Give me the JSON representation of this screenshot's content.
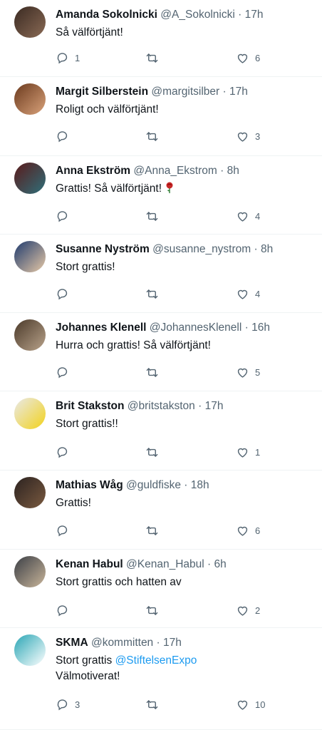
{
  "tweets": [
    {
      "name": "Amanda Sokolnicki",
      "handle": "@A_Sokolnicki",
      "time": "17h",
      "text": "Så välförtjänt!",
      "replies": "1",
      "retweets": "",
      "likes": "6",
      "avatar_colors": [
        "#3a2a22",
        "#8a6a55"
      ]
    },
    {
      "name": "Margit Silberstein",
      "handle": "@margitsilber",
      "time": "17h",
      "text": "Roligt och välförtjänt!",
      "replies": "",
      "retweets": "",
      "likes": "3",
      "avatar_colors": [
        "#6b3a1e",
        "#d9a27a"
      ]
    },
    {
      "name": "Anna Ekström",
      "handle": "@Anna_Ekstrom",
      "time": "8h",
      "text": "Grattis! Så välförtjänt!",
      "emoji": "rose-emoji",
      "replies": "",
      "retweets": "",
      "likes": "4",
      "avatar_colors": [
        "#5a1a1a",
        "#2f6f7a"
      ]
    },
    {
      "name": "Susanne Nyström",
      "handle": "@susanne_nystrom",
      "time": "8h",
      "text": "Stort grattis!",
      "replies": "",
      "retweets": "",
      "likes": "4",
      "avatar_colors": [
        "#1f3b6e",
        "#e7c9a6"
      ]
    },
    {
      "name": "Johannes Klenell",
      "handle": "@JohannesKlenell",
      "time": "16h",
      "text": "Hurra och grattis! Så välförtjänt!",
      "replies": "",
      "retweets": "",
      "likes": "5",
      "avatar_colors": [
        "#4b3a2a",
        "#b8a28a"
      ]
    },
    {
      "name": "Brit Stakston",
      "handle": "@britstakston",
      "time": "17h",
      "text": "Stort grattis!!",
      "replies": "",
      "retweets": "",
      "likes": "1",
      "avatar_colors": [
        "#e9e9e9",
        "#f2d21b"
      ]
    },
    {
      "name": "Mathias Wåg",
      "handle": "@guldfiske",
      "time": "18h",
      "text": "Grattis!",
      "replies": "",
      "retweets": "",
      "likes": "6",
      "avatar_colors": [
        "#2b2220",
        "#7a5a40"
      ]
    },
    {
      "name": "Kenan Habul",
      "handle": "@Kenan_Habul",
      "time": "6h",
      "text": "Stort grattis och hatten av",
      "replies": "",
      "retweets": "",
      "likes": "2",
      "avatar_colors": [
        "#3b3f46",
        "#c9b59a"
      ]
    },
    {
      "name": "SKMA",
      "handle": "@kommitten",
      "time": "17h",
      "text": "Stort grattis",
      "link": "@StiftelsenExpo",
      "text2": "Välmotiverat!",
      "replies": "3",
      "retweets": "",
      "likes": "10",
      "avatar_colors": [
        "#2aa6b5",
        "#ffffff"
      ]
    }
  ],
  "separator": "·",
  "colors": {
    "name": "#0f1419",
    "secondary": "#536471",
    "link": "#1d9bf0",
    "divider": "#eff3f4"
  },
  "icons": {
    "reply": "reply-icon",
    "retweet": "retweet-icon",
    "like": "heart-icon"
  }
}
